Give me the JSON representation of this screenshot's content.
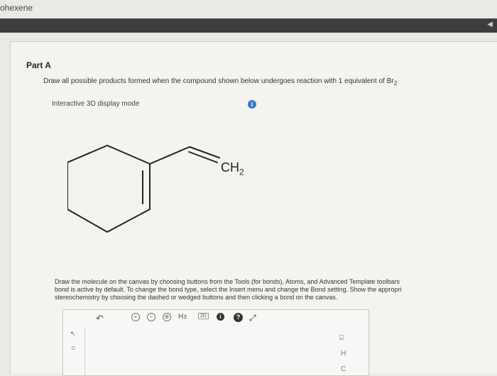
{
  "window": {
    "title": "ohexene"
  },
  "part": {
    "label": "Part A"
  },
  "question": {
    "instruction_prefix": "Draw all possible products formed when the compound shown below undergoes reaction with 1 equivalent of Br",
    "instruction_sub": "2",
    "mode_label": "Interactive 3D display mode",
    "info_icon": "i"
  },
  "molecule": {
    "ch2_main": "CH",
    "ch2_sub": "2"
  },
  "drawing_instructions": [
    "Draw the molecule on the canvas by choosing buttons from the Tools (for bonds), Atoms, and Advanced Template toolbars",
    "bond is active by default. To change the bond type, select the Insert menu and change the Bond setting. Show the appropri",
    "stereochemistry by choosing the dashed or wedged buttons and then clicking a bond on the canvas."
  ],
  "toolbar": {
    "undo": "↶",
    "zoom_in": "+",
    "zoom_out": "−",
    "zoom_reset": "⊗",
    "hydrogen_toggle": "H±",
    "template": "2D",
    "info": "i",
    "help": "?",
    "expand": "⤢"
  },
  "left_tools": {
    "select": "↖",
    "lasso": "○"
  },
  "right_tools": {
    "grid": "⌸",
    "atom_h": "H",
    "atom_c": "C"
  }
}
